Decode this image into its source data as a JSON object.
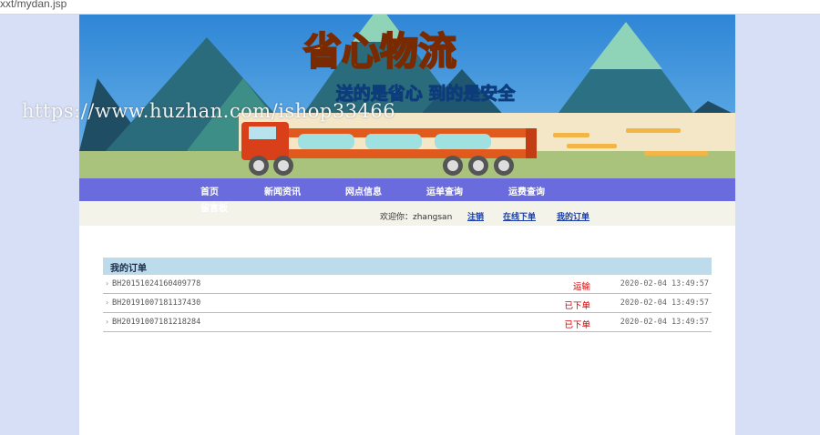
{
  "browser": {
    "url": "xxt/mydan.jsp"
  },
  "banner": {
    "title": "省心物流",
    "slogan": "送的是省心 到的是安全"
  },
  "nav": {
    "items": [
      "首页",
      "新闻资讯",
      "网点信息",
      "运单查询",
      "运费查询"
    ],
    "extra": "留言板"
  },
  "user_bar": {
    "welcome": "欢迎你：zhangsan",
    "logout": "注销",
    "place_order": "在线下单",
    "my_orders": "我的订单"
  },
  "orders": {
    "title": "我的订单",
    "rows": [
      {
        "id": "BH20151024160409778",
        "status": "运输",
        "time": "2020-02-04 13:49:57"
      },
      {
        "id": "BH20191007181137430",
        "status": "已下单",
        "time": "2020-02-04 13:49:57"
      },
      {
        "id": "BH20191007181218284",
        "status": "已下单",
        "time": "2020-02-04 13:49:57"
      }
    ]
  },
  "watermark": "https://www.huzhan.com/ishop33466"
}
